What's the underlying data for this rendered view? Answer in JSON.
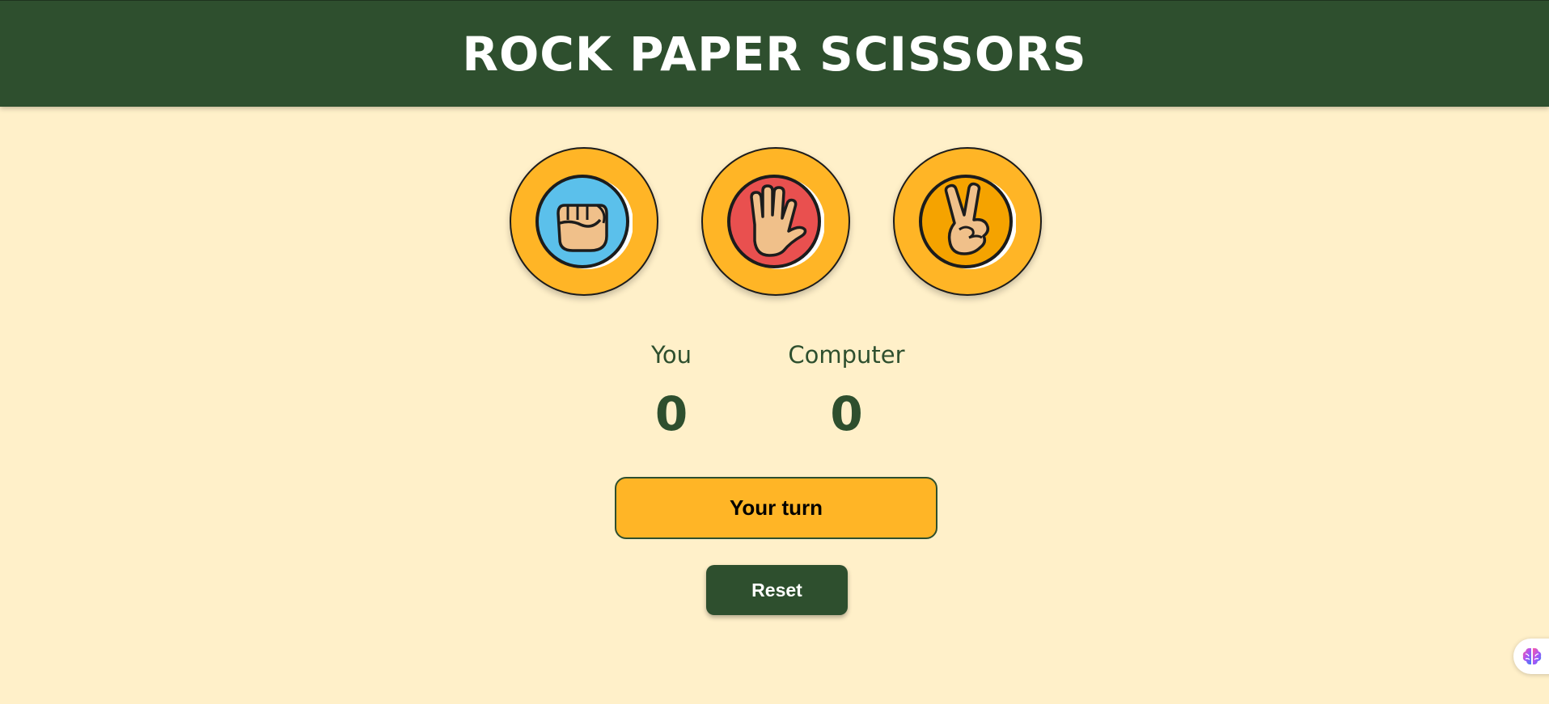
{
  "header": {
    "title": "ROCK PAPER SCISSORS"
  },
  "choices": [
    {
      "name": "rock",
      "icon": "rock-fist-icon",
      "inner_color": "#5bc0eb"
    },
    {
      "name": "paper",
      "icon": "paper-hand-icon",
      "inner_color": "#e9504f"
    },
    {
      "name": "scissors",
      "icon": "scissors-peace-icon",
      "inner_color": "#f5a300"
    }
  ],
  "scoreboard": {
    "player_label": "You",
    "player_score": "0",
    "computer_label": "Computer",
    "computer_score": "0"
  },
  "status": {
    "message": "Your turn"
  },
  "controls": {
    "reset_label": "Reset"
  },
  "extension": {
    "icon": "brain-icon"
  },
  "colors": {
    "header_bg": "#2e4f2e",
    "page_bg": "#fff0c9",
    "accent": "#ffb526",
    "text_dark": "#2e4f2e"
  }
}
